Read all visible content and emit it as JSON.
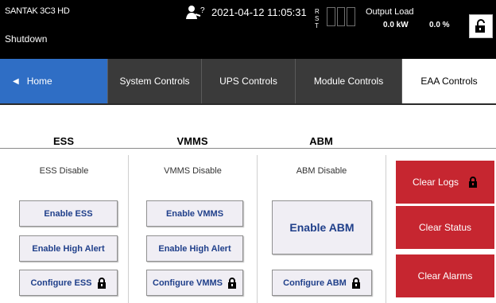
{
  "status_bar": {
    "model": "SANTAK 3C3 HD",
    "state": "Shutdown",
    "alarm_badge": "?",
    "datetime": "2021-04-12 11:05:31",
    "phases": [
      "R",
      "S",
      "T"
    ],
    "output_load_label": "Output Load",
    "output_load_kw": "0.0 kW",
    "output_load_pct": "0.0 %"
  },
  "tabs": {
    "home": "Home",
    "system": "System Controls",
    "ups": "UPS Controls",
    "module": "Module Controls",
    "eaa": "EAA Controls"
  },
  "ess": {
    "header": "ESS",
    "status": "ESS Disable",
    "enable": "Enable ESS",
    "high_alert": "Enable High Alert",
    "configure": "Configure ESS"
  },
  "vmms": {
    "header": "VMMS",
    "status": "VMMS Disable",
    "enable": "Enable VMMS",
    "high_alert": "Enable High Alert",
    "configure": "Configure VMMS"
  },
  "abm": {
    "header": "ABM",
    "status": "ABM Disable",
    "enable": "Enable ABM",
    "configure": "Configure ABM"
  },
  "actions": {
    "clear_logs": "Clear Logs",
    "clear_status": "Clear Status",
    "clear_alarms": "Clear Alarms"
  },
  "colors": {
    "home_tab": "#2f6ec5",
    "tab_inactive": "#3a3a3a",
    "danger": "#c62630",
    "button_text": "#1f3f8a"
  }
}
